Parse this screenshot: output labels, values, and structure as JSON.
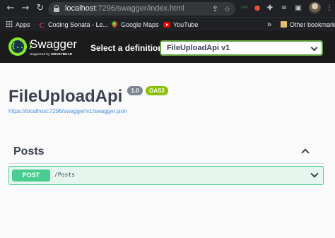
{
  "browser": {
    "url_host": "localhost",
    "url_path": ":7296/swagger/index.html",
    "icons": [
      "back-icon",
      "forward-icon",
      "reload-icon",
      "lock-icon",
      "share-icon",
      "star-icon"
    ]
  },
  "bookmarks": {
    "items": [
      {
        "label": "Apps",
        "icon": "apps-grid-icon"
      },
      {
        "label": "Coding Sonata - Le...",
        "icon": "coding-sonata-icon"
      },
      {
        "label": "Google Maps",
        "icon": "google-maps-icon"
      },
      {
        "label": "YouTube",
        "icon": "youtube-icon"
      }
    ],
    "overflow": "»",
    "other": "Other bookmarks"
  },
  "swagger": {
    "brand": "Swagger",
    "sub_prefix": "Supported by ",
    "sub_brand": "SMARTBEAR",
    "logo_glyph": "{...}",
    "definition_label": "Select a definition",
    "definition_value": "FileUploadApi v1"
  },
  "info": {
    "title": "FileUploadApi",
    "version": "1.0",
    "oas": "OAS3",
    "spec_url": "https://localhost:7296/swagger/v1/swagger.json"
  },
  "tags": [
    {
      "name": "Posts",
      "operations": [
        {
          "method": "POST",
          "path": "/Posts"
        }
      ]
    }
  ],
  "colors": {
    "swagger_green": "#85ea2d",
    "post_green": "#49cc90",
    "oas_badge": "#89bf04",
    "link_blue": "#4990e2",
    "text_dark": "#3b4151"
  }
}
